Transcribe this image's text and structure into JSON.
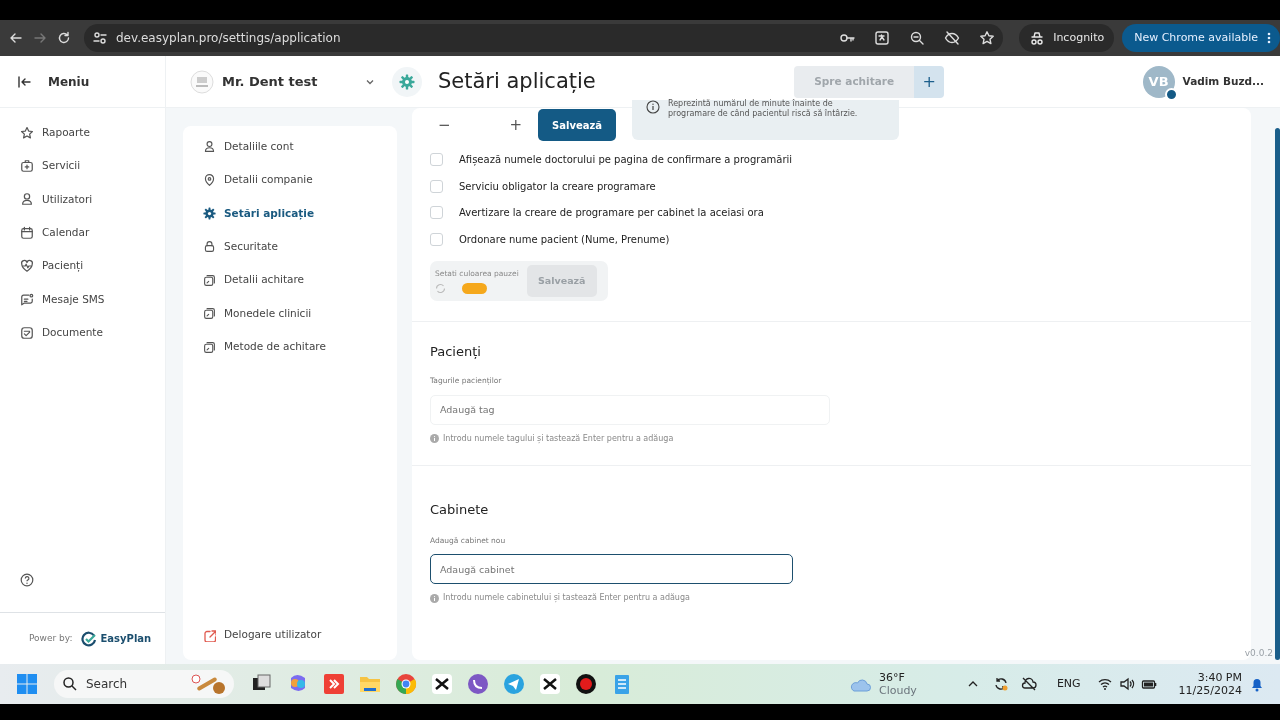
{
  "browser": {
    "url": "dev.easyplan.pro/settings/application",
    "incognito_label": "Incognito",
    "update_button": "New Chrome available"
  },
  "header": {
    "menu_label": "Meniu",
    "clinic": "Mr. Dent test",
    "page_title": "Setări aplicație",
    "pay_button": "Spre achitare",
    "add_button": "+",
    "user_initials": "VB",
    "user_name": "Vadim Buzd..."
  },
  "sidebar": {
    "items": [
      {
        "label": "Rapoarte"
      },
      {
        "label": "Servicii"
      },
      {
        "label": "Utilizatori"
      },
      {
        "label": "Calendar"
      },
      {
        "label": "Pacienți"
      },
      {
        "label": "Mesaje SMS"
      },
      {
        "label": "Documente"
      }
    ],
    "power_label": "Power by:",
    "brand": "EasyPlan"
  },
  "settings_nav": {
    "items": [
      {
        "label": "Detaliile cont",
        "selected": false
      },
      {
        "label": "Detalii companie",
        "selected": false
      },
      {
        "label": "Setări aplicație",
        "selected": true
      },
      {
        "label": "Securitate",
        "selected": false
      },
      {
        "label": "Detalii achitare",
        "selected": false
      },
      {
        "label": "Monedele clinicii",
        "selected": false
      },
      {
        "label": "Metode de achitare",
        "selected": false
      }
    ],
    "delegate_link": "Delogare utilizator"
  },
  "stepper": {
    "minus": "−",
    "plus": "+",
    "save_button": "Salvează",
    "info": "Reprezintă numărul de minute înainte de programare de când pacientul riscă să întârzie."
  },
  "options": [
    {
      "label": "Afișează numele doctorului pe pagina de confirmare a programării",
      "checked": false
    },
    {
      "label": "Serviciu obligator la creare programare",
      "checked": false
    },
    {
      "label": "Avertizare la creare de programare per cabinet la aceiasi ora",
      "checked": false
    },
    {
      "label": "Ordonare nume pacient (Nume, Prenume)",
      "checked": false
    }
  ],
  "pause_color": {
    "label": "Setati culoarea pauzei",
    "color": "#f5a81c",
    "save_button": "Salvează"
  },
  "sections": [
    {
      "title": "Pacienți",
      "field_label": "Tagurile pacienților",
      "placeholder": "Adaugă tag",
      "focused": false,
      "hint": "Introdu numele tagului și tastează Enter pentru a adăuga"
    },
    {
      "title": "Cabinete",
      "field_label": "Adaugă cabinet nou",
      "placeholder": "Adaugă cabinet",
      "focused": true,
      "hint": "Introdu numele cabinetului și tastează Enter pentru a adăuga"
    }
  ],
  "version": "v0.0.2",
  "taskbar": {
    "search_placeholder": "Search",
    "weather_temp": "36°F",
    "weather_text": "Cloudy",
    "language": "ENG",
    "time": "3:40 PM",
    "date": "11/25/2024"
  }
}
